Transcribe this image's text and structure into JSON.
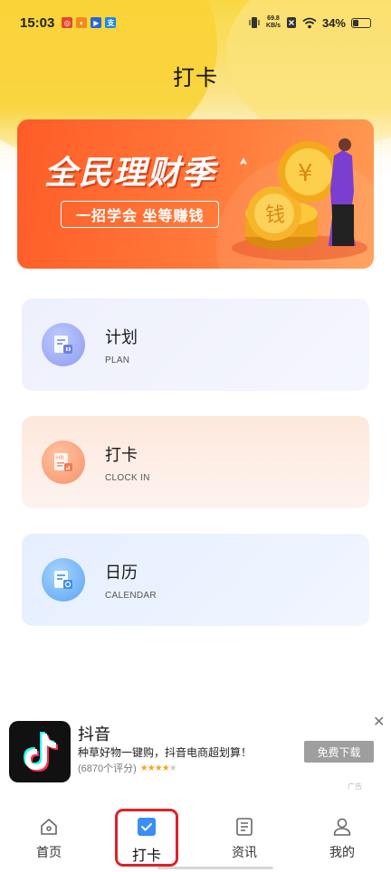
{
  "status_bar": {
    "time": "15:03",
    "net_speed_value": "69.8",
    "net_speed_unit": "KB/s",
    "battery_percent": "34%",
    "battery_level": 0.34
  },
  "page": {
    "title": "打卡"
  },
  "banner": {
    "title": "全民理财季",
    "subtitle": "一招学会 坐等赚钱",
    "coin_text": "钱"
  },
  "menu": {
    "plan": {
      "title": "计划",
      "subtitle": "PLAN"
    },
    "clock_in": {
      "title": "打卡",
      "subtitle": "CLOCK IN"
    },
    "calendar": {
      "title": "日历",
      "subtitle": "CALENDAR"
    }
  },
  "ad": {
    "app_name": "抖音",
    "description": "种草好物一键购，抖音电商超划算！",
    "rating_count": "(6870个评分)",
    "rating_stars": 4,
    "button_label": "免费下载",
    "tag": "广告",
    "close_symbol": "✕"
  },
  "bottom_nav": {
    "home": "首页",
    "clock_in": "打卡",
    "news": "资讯",
    "mine": "我的"
  },
  "colors": {
    "accent_orange": "#ff6a30",
    "highlight_red": "#e0202a",
    "nav_active_blue": "#3a8ef6"
  }
}
